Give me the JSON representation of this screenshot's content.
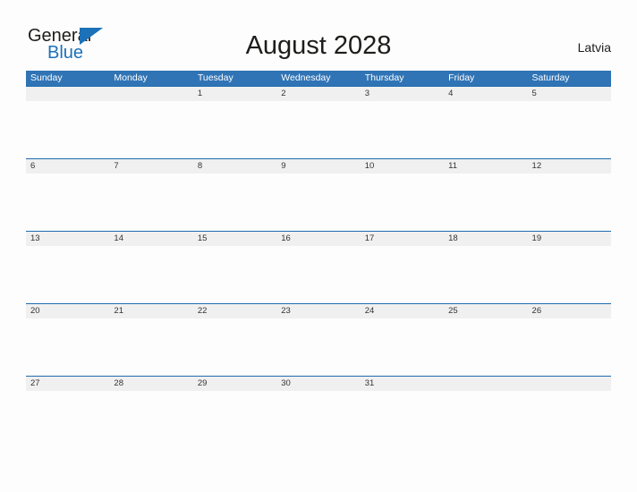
{
  "brand": {
    "name_top": "General",
    "name_bottom": "Blue",
    "flag_icon": "blue-triangle-flag-icon",
    "color_top": "#1d1d1b",
    "color_bottom": "#1c71b9"
  },
  "header": {
    "title": "August 2028",
    "country": "Latvia"
  },
  "colors": {
    "header_blue": "#3074b5",
    "row_line_blue": "#1f6cb0",
    "date_band_gray": "#f0f0f0",
    "page_background": "#fdfdfd",
    "text_dark": "#1d1d1b"
  },
  "calendar": {
    "month": "August",
    "year": "2028",
    "weekday_headers": [
      "Sunday",
      "Monday",
      "Tuesday",
      "Wednesday",
      "Thursday",
      "Friday",
      "Saturday"
    ],
    "weeks": [
      {
        "days": [
          "",
          "",
          "1",
          "2",
          "3",
          "4",
          "5"
        ]
      },
      {
        "days": [
          "6",
          "7",
          "8",
          "9",
          "10",
          "11",
          "12"
        ]
      },
      {
        "days": [
          "13",
          "14",
          "15",
          "16",
          "17",
          "18",
          "19"
        ]
      },
      {
        "days": [
          "20",
          "21",
          "22",
          "23",
          "24",
          "25",
          "26"
        ]
      },
      {
        "days": [
          "27",
          "28",
          "29",
          "30",
          "31",
          "",
          ""
        ]
      }
    ]
  }
}
